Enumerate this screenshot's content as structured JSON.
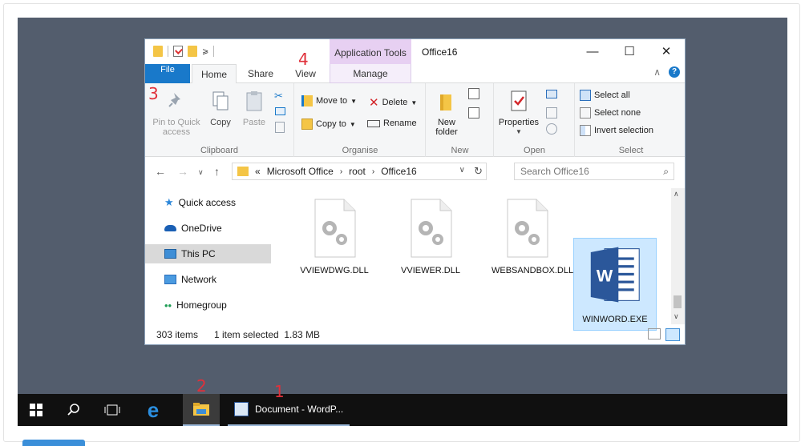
{
  "window": {
    "title": "Office16",
    "contextual_tab_group": "Application Tools",
    "tabs": [
      "File",
      "Home",
      "Share",
      "View",
      "Manage"
    ]
  },
  "ribbon": {
    "clipboard": {
      "label": "Clipboard",
      "pin_label": "Pin to Quick access",
      "copy_label": "Copy",
      "paste_label": "Paste"
    },
    "organise": {
      "label": "Organise",
      "move_to": "Move to",
      "copy_to": "Copy to",
      "delete": "Delete",
      "rename": "Rename"
    },
    "new": {
      "label": "New",
      "new_folder": "New folder"
    },
    "open": {
      "label": "Open",
      "properties": "Properties"
    },
    "select": {
      "label": "Select",
      "select_all": "Select all",
      "select_none": "Select none",
      "invert": "Invert selection"
    }
  },
  "address": {
    "prefix": "«",
    "segments": [
      "Microsoft Office",
      "root",
      "Office16"
    ],
    "search_placeholder": "Search Office16"
  },
  "nav": {
    "items": [
      "Quick access",
      "OneDrive",
      "This PC",
      "Network",
      "Homegroup"
    ],
    "selected": "This PC"
  },
  "files": [
    {
      "name": "VVIEWDWG.DLL",
      "type": "dll"
    },
    {
      "name": "VVIEWER.DLL",
      "type": "dll"
    },
    {
      "name": "WEBSANDBOX.DLL",
      "type": "dll"
    },
    {
      "name": "WINWORD.EXE",
      "type": "word",
      "selected": true
    }
  ],
  "status": {
    "count": "303 items",
    "selection": "1 item selected  1.83 MB"
  },
  "taskbar": {
    "app_label": "Document - WordP..."
  },
  "markers": [
    "1",
    "2",
    "3",
    "4"
  ],
  "colors": {
    "accent": "#1979ca",
    "desktop": "#535d6d",
    "marker": "#e0303a",
    "contextual": "#e7d0f2",
    "selection": "#cde8ff"
  }
}
